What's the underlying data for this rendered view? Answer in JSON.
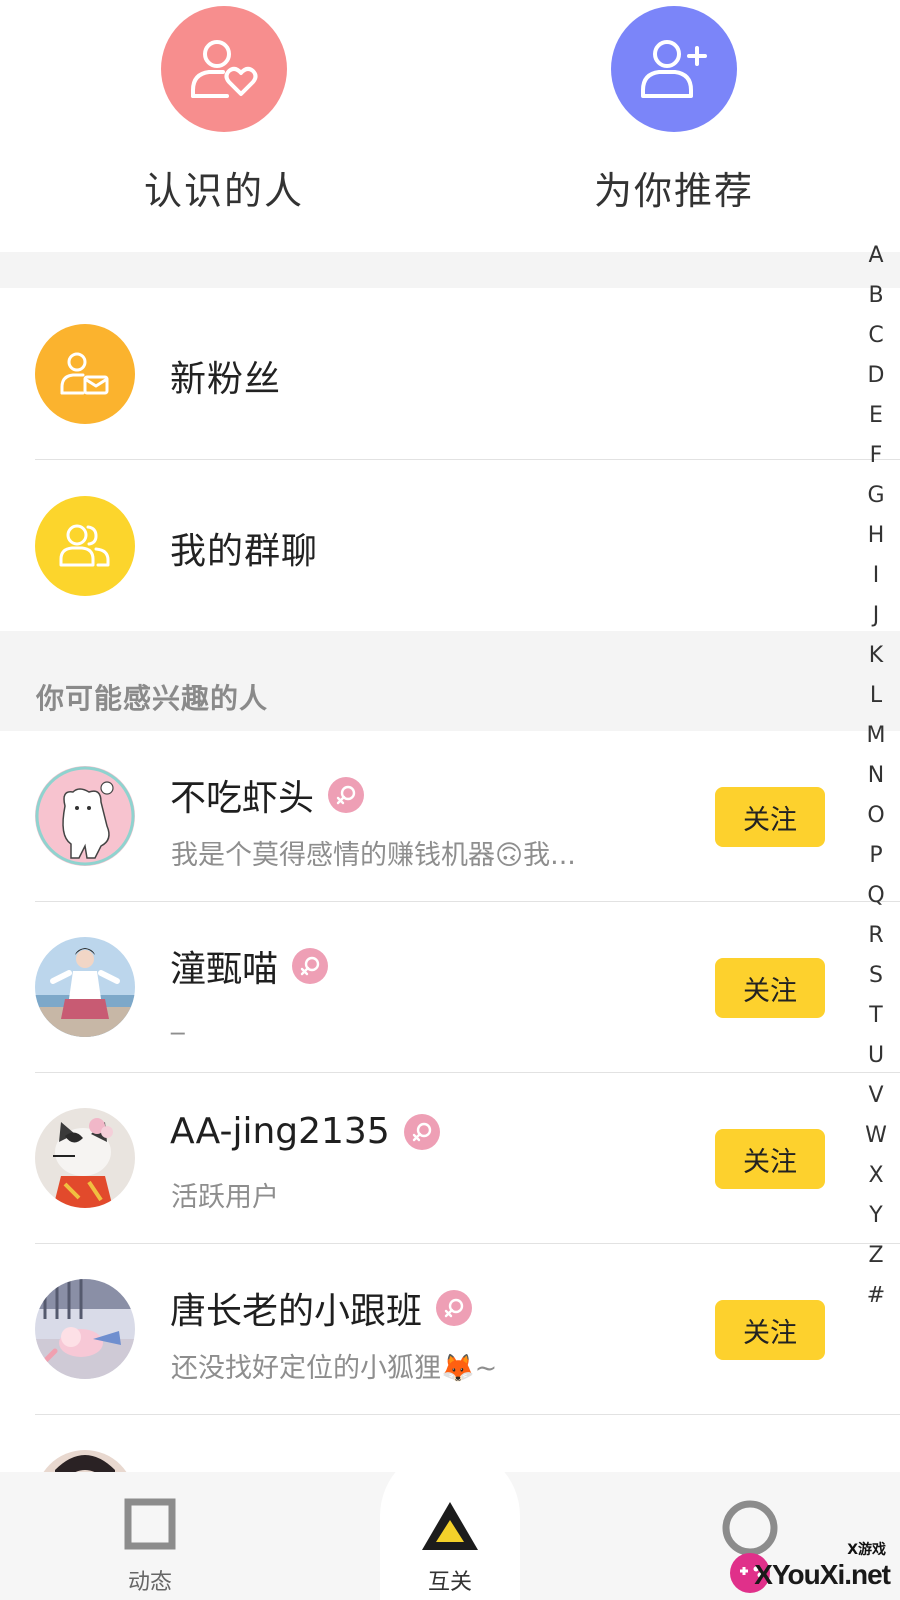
{
  "top_actions": [
    {
      "label": "认识的人",
      "icon": "person-heart-icon",
      "color": "#f78e8e"
    },
    {
      "label": "为你推荐",
      "icon": "person-add-icon",
      "color": "#7b85f9"
    }
  ],
  "menu": [
    {
      "label": "新粉丝",
      "icon": "person-mail-icon",
      "color": "#fbb32e"
    },
    {
      "label": "我的群聊",
      "icon": "group-icon",
      "color": "#fcd52c"
    }
  ],
  "section_title": "你可能感兴趣的人",
  "users": [
    {
      "name": "不吃虾头",
      "bio": "我是个莫得感情的赚钱机器🙃我...",
      "gender": "female",
      "follow_label": "关注"
    },
    {
      "name": "潼甄喵",
      "bio": "_",
      "gender": "female",
      "follow_label": "关注"
    },
    {
      "name": "AA-jing2135",
      "bio": "活跃用户",
      "gender": "female",
      "follow_label": "关注"
    },
    {
      "name": "唐长老的小跟班",
      "bio": "还没找好定位的小狐狸🦊~",
      "gender": "female",
      "follow_label": "关注"
    }
  ],
  "index_letters": [
    "A",
    "B",
    "C",
    "D",
    "E",
    "F",
    "G",
    "H",
    "I",
    "J",
    "K",
    "L",
    "M",
    "N",
    "O",
    "P",
    "Q",
    "R",
    "S",
    "T",
    "U",
    "V",
    "W",
    "X",
    "Y",
    "Z",
    "#"
  ],
  "bottom_nav": [
    {
      "label": "动态",
      "icon": "square-icon"
    },
    {
      "label": "互关",
      "icon": "triangle-icon",
      "active": true
    },
    {
      "label": "",
      "icon": "circle-icon"
    }
  ],
  "watermark": {
    "small": "X游戏",
    "text": "XYouXi.net"
  },
  "colors": {
    "accent_yellow": "#fdd12d",
    "gender_female": "#ee9fb5",
    "band": "#f4f4f4"
  }
}
